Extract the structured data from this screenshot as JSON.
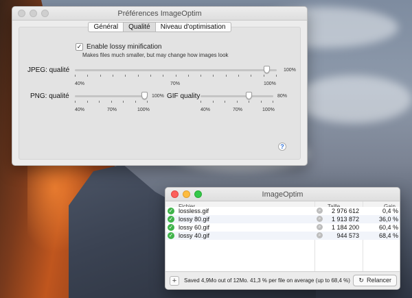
{
  "preferences": {
    "title": "Préférences ImageOptim",
    "tabs": [
      "Général",
      "Qualité",
      "Niveau d'optimisation"
    ],
    "selected_tab": 1,
    "lossy": {
      "label": "Enable lossy minification",
      "checked": true,
      "hint": "Makes files much smaller, but may change how images look"
    },
    "jpeg": {
      "label": "JPEG: qualité",
      "min": "40%",
      "mid": "70%",
      "max": "100%",
      "value": "100%",
      "level": 0.95
    },
    "png": {
      "label": "PNG: qualité",
      "min": "40%",
      "mid": "70%",
      "max": "100%",
      "value": "100%",
      "level": 0.95
    },
    "gif": {
      "label": "GIF quality",
      "min": "40%",
      "mid": "70%",
      "max": "100%",
      "value": "80%",
      "level": 0.66
    },
    "help_label": "?"
  },
  "imageoptim": {
    "title": "ImageOptim",
    "columns": {
      "file": "Fichier",
      "size": "Taille",
      "gain": "Gain"
    },
    "files": [
      {
        "name": "lossless.gif",
        "size": "2 976 612",
        "gain": "0,4 %"
      },
      {
        "name": "lossy 80.gif",
        "size": "1 913 872",
        "gain": "36,0 %"
      },
      {
        "name": "lossy 60.gif",
        "size": "1 184 200",
        "gain": "60,4 %"
      },
      {
        "name": "lossy 40.gif",
        "size": "944 573",
        "gain": "68,4 %"
      }
    ],
    "add_label": "+",
    "status": "Saved 4,9Mo out of 12Mo. 41,3 % per file on average (up to 68,4 %)",
    "rerun_label": "Relancer"
  },
  "colors": {
    "ok": "#3fb34a",
    "close": "#fc605c",
    "minimize": "#fdbc40",
    "zoom": "#34c84a"
  }
}
